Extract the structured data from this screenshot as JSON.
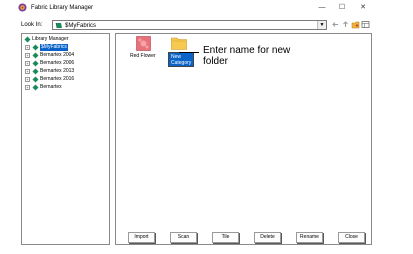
{
  "window": {
    "title": "Fabric Library Manager",
    "min_glyph": "—",
    "max_glyph": "☐",
    "close_glyph": "✕"
  },
  "lookin": {
    "label": "Look In:",
    "value": "$MyFabrics"
  },
  "tree": {
    "items": [
      {
        "label": "Library Manager",
        "expander": "",
        "selected": false
      },
      {
        "label": "$MyFabrics",
        "expander": "+",
        "selected": true
      },
      {
        "label": "Bernartex 2004",
        "expander": "+",
        "selected": false
      },
      {
        "label": "Bernartex 2006",
        "expander": "+",
        "selected": false
      },
      {
        "label": "Bernartex 2013",
        "expander": "+",
        "selected": false
      },
      {
        "label": "Bernartex 2016",
        "expander": "+",
        "selected": false
      },
      {
        "label": "Bernartex",
        "expander": "+",
        "selected": false
      }
    ]
  },
  "content": {
    "items": [
      {
        "label": "Red Flower",
        "icon": "fabric-swatch-icon"
      },
      {
        "label": "New Category",
        "icon": "folder-icon",
        "editing": true
      }
    ],
    "edit_line1": "New",
    "edit_line2": "Category"
  },
  "annotation": {
    "text": "Enter name for new folder"
  },
  "buttons": {
    "import": "Import",
    "scan": "Scan",
    "tile": "Tile",
    "delete": "Delete",
    "rename": "Rename",
    "close": "Close"
  },
  "colors": {
    "selection": "#0a63c9",
    "folder": "#f6c94f",
    "swatch": "#e8717a"
  }
}
